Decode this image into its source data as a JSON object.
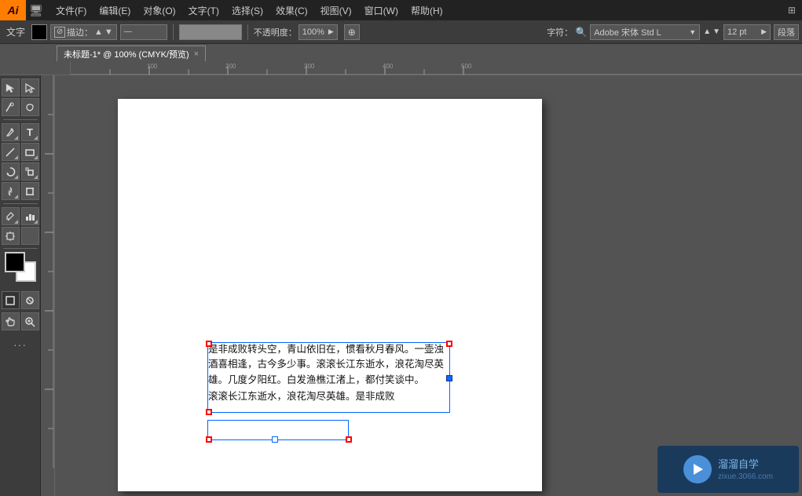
{
  "app": {
    "logo": "Ai",
    "title": "未标题-1 @ 100% (CMYK/预览)"
  },
  "menubar": {
    "items": [
      "文件(F)",
      "编辑(E)",
      "对象(O)",
      "文字(T)",
      "选择(S)",
      "效果(C)",
      "视图(V)",
      "窗口(W)",
      "帮助(H)"
    ]
  },
  "options_bar": {
    "label": "文字",
    "stroke_label": "描边：",
    "opacity_label": "不透明度：",
    "opacity_value": "100%",
    "font_label": "字符：",
    "font_name": "Adobe 宋体 Std L",
    "size_value": "12 pt",
    "size_label": "段落"
  },
  "tab": {
    "title": "未标题-1* @ 100% (CMYK/预览)",
    "close": "×"
  },
  "canvas": {
    "text_content_1": "是非成败转头空，青山依旧在，惯看秋月春风。一壶浊酒喜相逢，古今多少事。滚滚长江东逝水，浪花淘尽英雄。几度夕阳红。白发渔樵江渚上，都付笑谈中。",
    "text_content_2": "滚滚长江东逝水，浪花淘尽英雄。是非成败"
  },
  "watermark": {
    "site": "溜溜自学",
    "url": "zixue.3066.com"
  },
  "tools": [
    {
      "name": "selection",
      "icon": "↖",
      "label": "选择工具"
    },
    {
      "name": "direct-selection",
      "icon": "↖",
      "label": "直接选择工具"
    },
    {
      "name": "magic-wand",
      "icon": "✦",
      "label": "魔棒工具"
    },
    {
      "name": "lasso",
      "icon": "⌀",
      "label": "套索工具"
    },
    {
      "name": "pen",
      "icon": "✒",
      "label": "钢笔工具"
    },
    {
      "name": "type",
      "icon": "T",
      "label": "文字工具"
    },
    {
      "name": "line",
      "icon": "/",
      "label": "直线工具"
    },
    {
      "name": "rectangle",
      "icon": "□",
      "label": "矩形工具"
    },
    {
      "name": "rotate",
      "icon": "↺",
      "label": "旋转工具"
    },
    {
      "name": "scale",
      "icon": "⤢",
      "label": "比例缩放工具"
    },
    {
      "name": "warp",
      "icon": "⊕",
      "label": "变形工具"
    },
    {
      "name": "free-transform",
      "icon": "⊞",
      "label": "自由变换工具"
    },
    {
      "name": "eyedropper",
      "icon": "⌁",
      "label": "吸管工具"
    },
    {
      "name": "chart",
      "icon": "▦",
      "label": "图表工具"
    },
    {
      "name": "artboard",
      "icon": "▣",
      "label": "画板工具"
    },
    {
      "name": "hand",
      "icon": "✋",
      "label": "抓手工具"
    },
    {
      "name": "zoom",
      "icon": "⌕",
      "label": "缩放工具"
    }
  ]
}
